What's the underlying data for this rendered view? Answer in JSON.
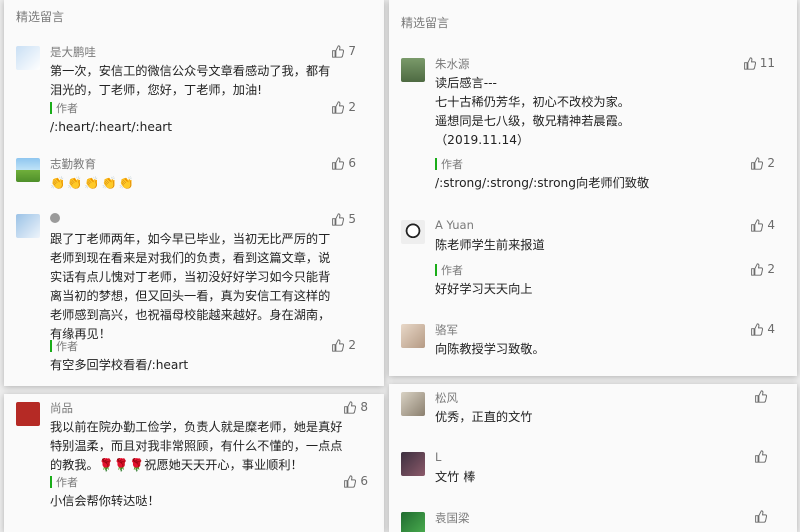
{
  "left_top": {
    "title": "精选留言",
    "comments": [
      {
        "name": "是大鹏哇",
        "likes": "7",
        "text": "第一次，安信工的微信公众号文章看感动了我，都有泪光的，丁老师，您好，丁老师，加油!",
        "reply": {
          "author": "作者",
          "likes": "2",
          "text": "/:heart/:heart/:heart"
        }
      },
      {
        "name": "志勤教育",
        "likes": "6",
        "text": "👏👏👏👏👏"
      },
      {
        "name": "",
        "likes": "5",
        "text": "跟了丁老师两年，如今早已毕业，当初无比严厉的丁老师到现在看来是对我们的负责，看到这篇文章，说实话有点儿愧对丁老师，当初没好好学习如今只能背离当初的梦想，但又回头一看，真为安信工有这样的老师感到高兴，也祝福母校能越来越好。身在湖南，有缘再见！",
        "reply": {
          "author": "作者",
          "likes": "2",
          "text": "有空多回学校看看/:heart"
        }
      }
    ]
  },
  "left_bottom": {
    "comments": [
      {
        "name": "尚品",
        "likes": "8",
        "text": "我以前在院办勤工俭学，负责人就是糜老师，她是真好特别温柔，而且对我非常照顾，有什么不懂的，一点点的教我。🌹🌹🌹祝愿她天天开心，事业顺利！",
        "reply": {
          "author": "作者",
          "likes": "6",
          "text": "小信会帮你转达哒！"
        }
      }
    ]
  },
  "right_top": {
    "title": "精选留言",
    "comments": [
      {
        "name": "朱水源",
        "likes": "11",
        "text": "读后感言---\n七十古稀仍芳华，初心不改校为家。\n遥想同是七八级，敬兄精神若晨霞。\n（2019.11.14）",
        "reply": {
          "author": "作者",
          "likes": "2",
          "text": "/:strong/:strong/:strong向老师们致敬"
        }
      },
      {
        "name": "A Yuan",
        "likes": "4",
        "text": "陈老师学生前来报道",
        "reply": {
          "author": "作者",
          "likes": "2",
          "text": "好好学习天天向上"
        }
      },
      {
        "name": "骆军",
        "likes": "4",
        "text": "向陈教授学习致敬。"
      }
    ]
  },
  "right_bottom": {
    "comments": [
      {
        "name": "松风",
        "likes": "",
        "text": "优秀，正直的文竹"
      },
      {
        "name": "L",
        "likes": "",
        "text": "文竹 棒"
      },
      {
        "name": "袁国梁",
        "likes": "",
        "text": ""
      }
    ]
  },
  "colors": {
    "author_bar": "#1aad19",
    "name_text": "#7a7a7a",
    "card_bg": "#fafafa"
  },
  "icons": {
    "like": "thumbs-up-icon"
  }
}
